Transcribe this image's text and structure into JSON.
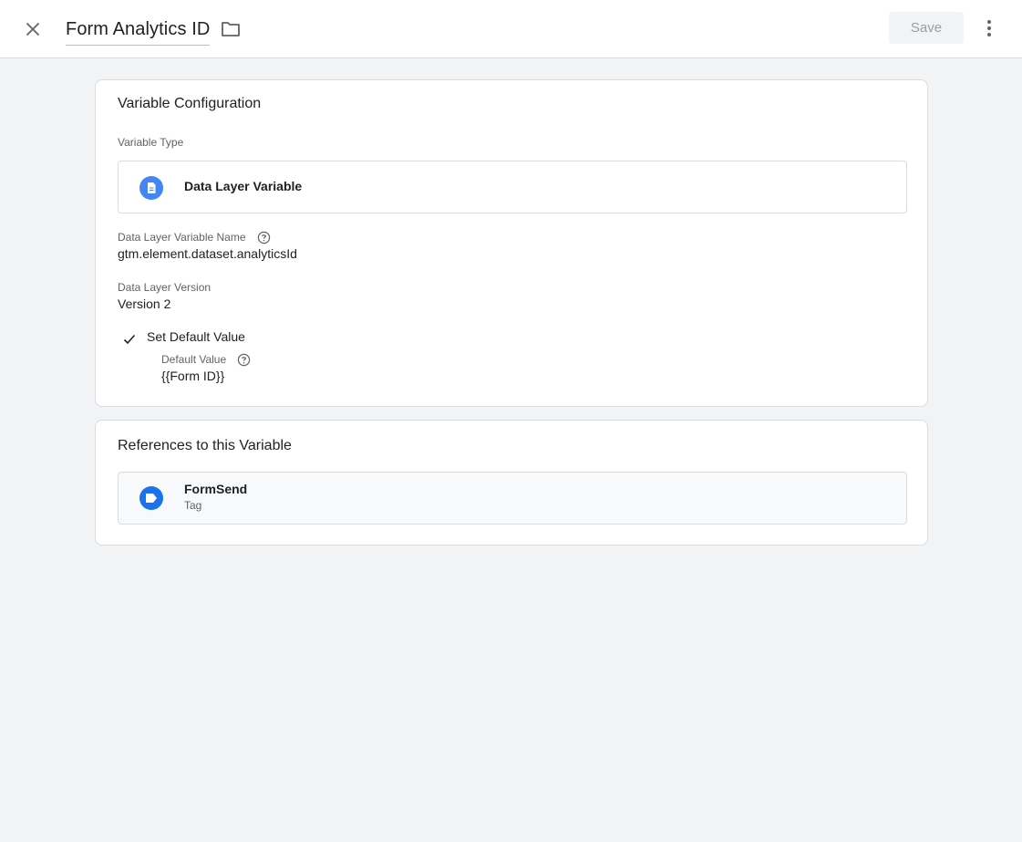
{
  "header": {
    "title": "Form Analytics ID",
    "save_label": "Save",
    "close_icon": "close-icon",
    "folder_icon": "folder-icon",
    "more_icon": "more-vert-icon"
  },
  "variable_configuration": {
    "card_title": "Variable Configuration",
    "variable_type_label": "Variable Type",
    "variable_type_name": "Data Layer Variable",
    "variable_type_icon": "document-icon",
    "dlv_name_label": "Data Layer Variable Name",
    "dlv_name_value": "gtm.element.dataset.analyticsId",
    "dl_version_label": "Data Layer Version",
    "dl_version_value": "Version 2",
    "set_default_label": "Set Default Value",
    "default_value_label": "Default Value",
    "default_value": "{{Form ID}}"
  },
  "references": {
    "card_title": "References to this Variable",
    "items": [
      {
        "name": "FormSend",
        "type": "Tag",
        "icon": "tag-icon"
      }
    ]
  },
  "colors": {
    "accent": "#1a73e8",
    "type_icon": "#4285f4",
    "background": "#f1f3f4"
  }
}
